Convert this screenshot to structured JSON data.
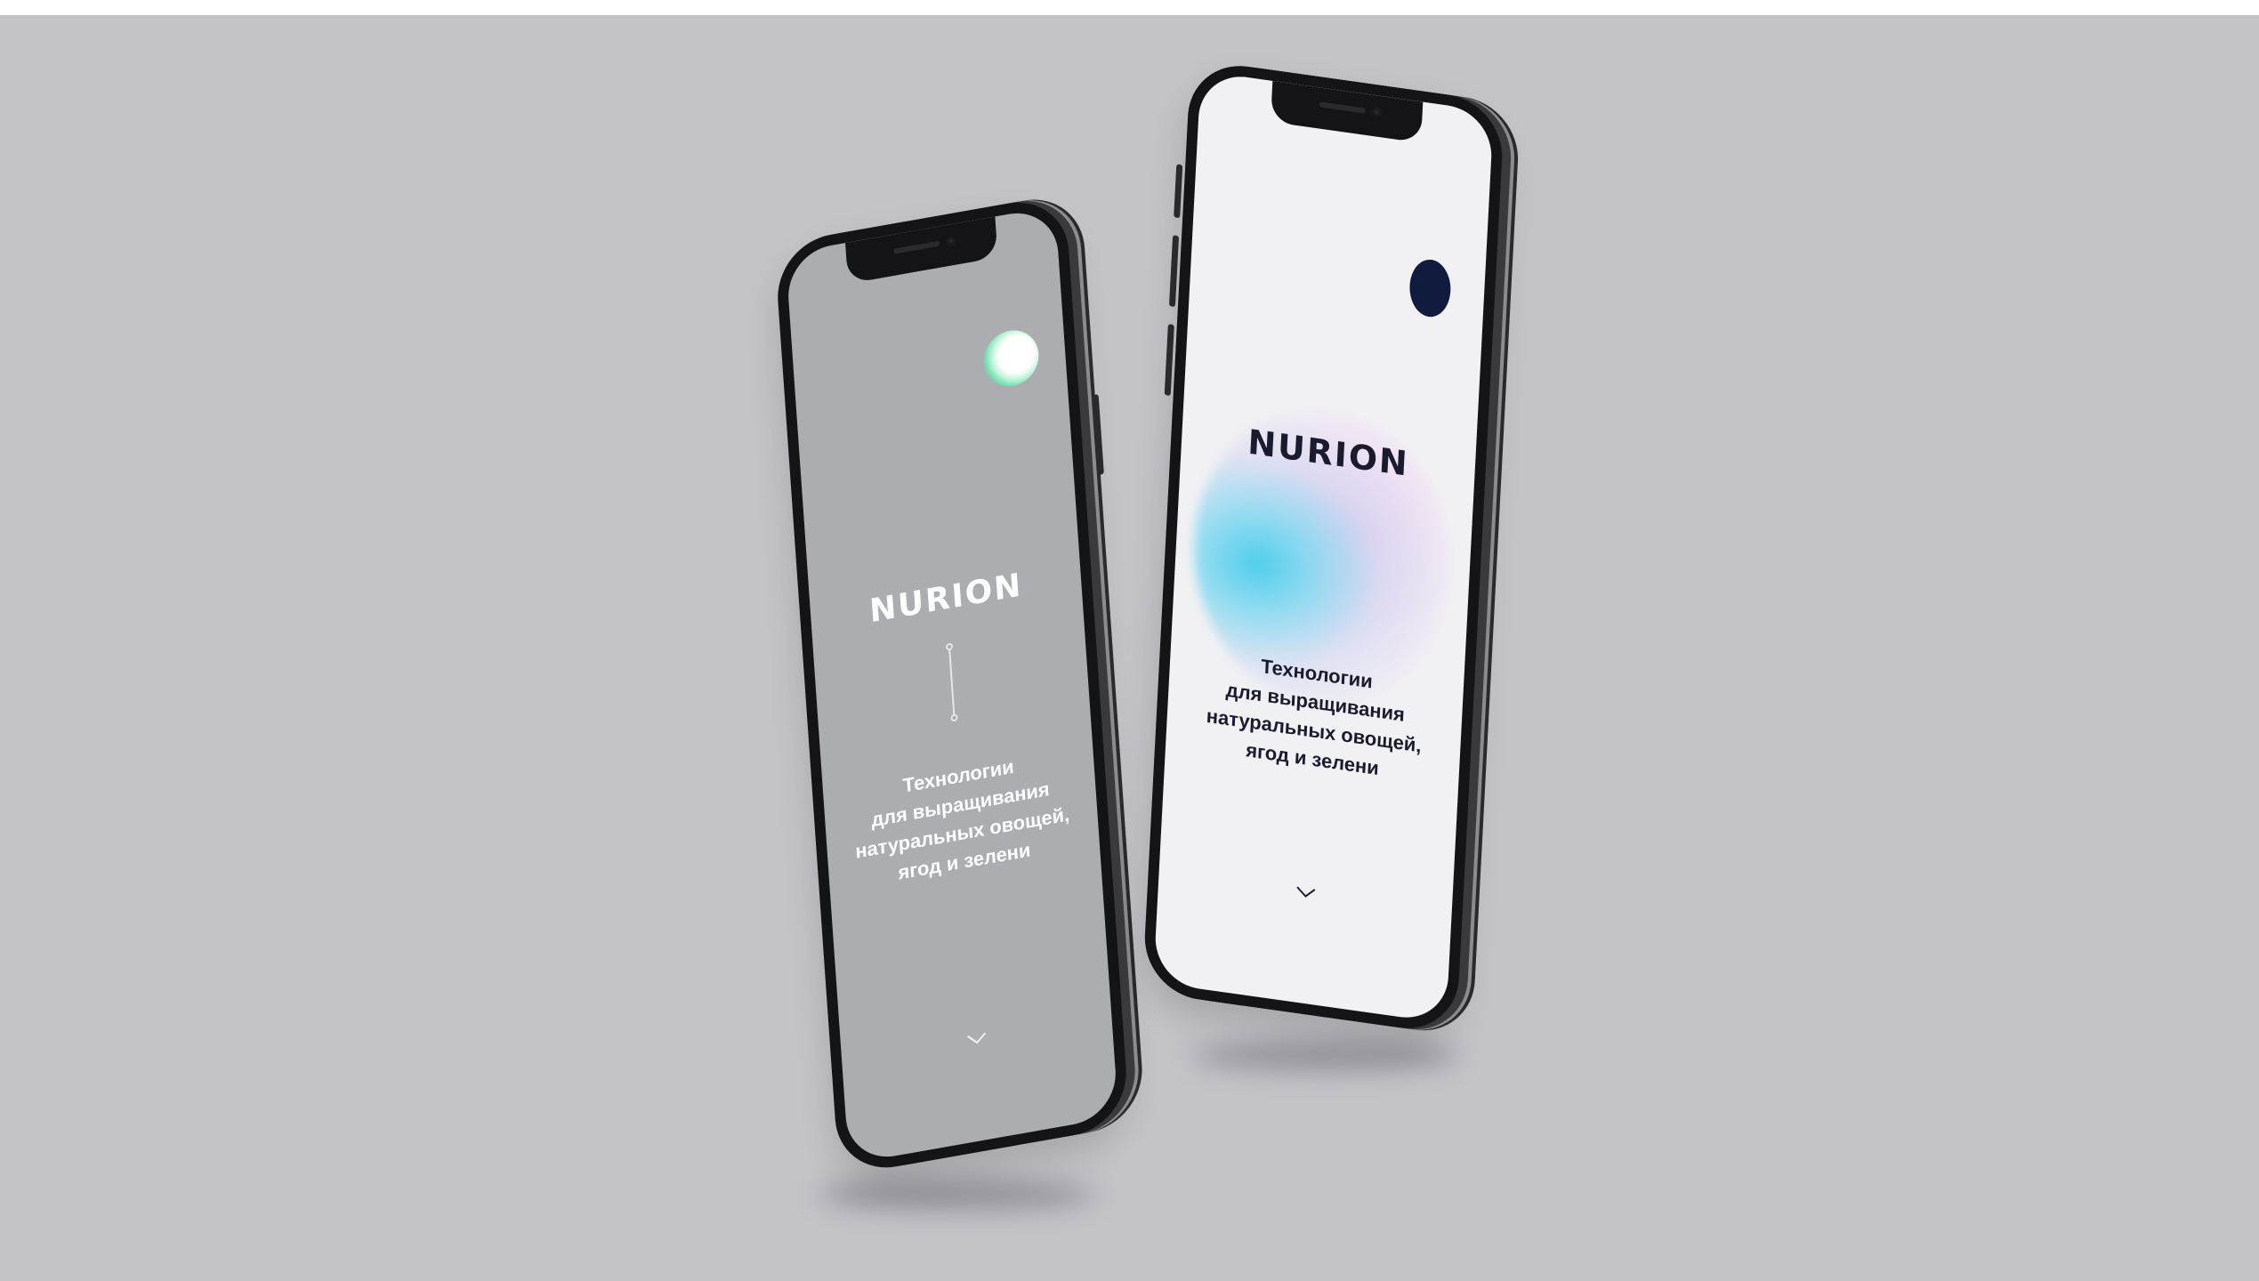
{
  "brand": "NURION",
  "tagline_lines": [
    "Технологии",
    "для выращивания",
    "натуральных овощей,",
    "ягод и зелени"
  ],
  "colors": {
    "background": "#c4c3c8",
    "left_screen": "#acadb1",
    "right_screen": "#f1f1f3",
    "brand_dark": "#1a1b2e",
    "accent_green": "#6fe0b0",
    "accent_navy": "#101b3d",
    "accent_cyan": "#46cdeb"
  },
  "icons": {
    "scroll_down": "chevron-down-icon"
  }
}
